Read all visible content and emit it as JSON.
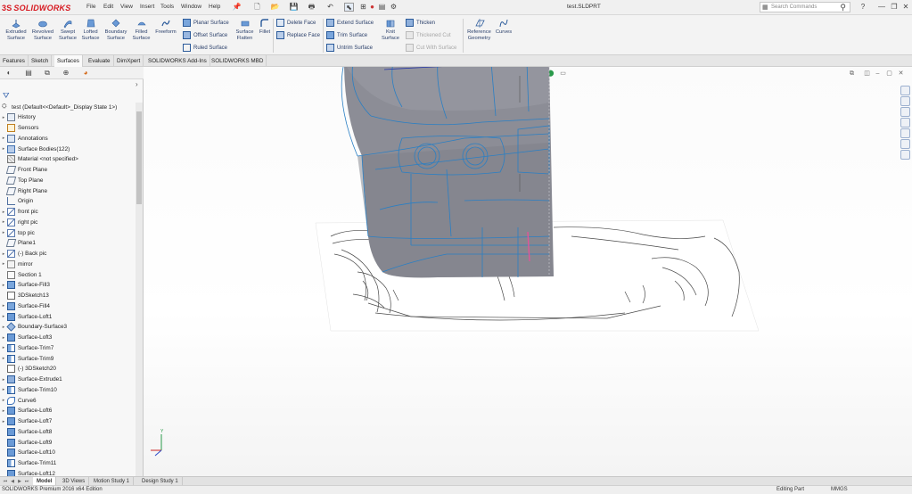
{
  "app": {
    "logo_ds": "3S",
    "logo_text": "SOLIDWORKS",
    "document_title": "test.SLDPRT"
  },
  "menu": [
    "File",
    "Edit",
    "View",
    "Insert",
    "Tools",
    "Window",
    "Help"
  ],
  "search": {
    "placeholder": "Search Commands"
  },
  "window_controls": [
    "?",
    "—",
    "❐",
    "✕"
  ],
  "ribbon": {
    "large_buttons": [
      {
        "label": "Extruded\nSurface",
        "icon": "extruded-surface-icon"
      },
      {
        "label": "Revolved\nSurface",
        "icon": "revolved-surface-icon"
      },
      {
        "label": "Swept\nSurface",
        "icon": "swept-surface-icon"
      },
      {
        "label": "Lofted\nSurface",
        "icon": "lofted-surface-icon"
      },
      {
        "label": "Boundary\nSurface",
        "icon": "boundary-surface-icon"
      },
      {
        "label": "Filled\nSurface",
        "icon": "filled-surface-icon"
      },
      {
        "label": "Freeform",
        "icon": "freeform-icon"
      }
    ],
    "group1": [
      "Planar Surface",
      "Offset Surface",
      "Ruled Surface"
    ],
    "flatten": {
      "label": "Surface\nFlatten"
    },
    "fillet": {
      "label": "Fillet"
    },
    "group2": [
      "Delete Face",
      "Replace Face"
    ],
    "group3": [
      "Extend Surface",
      "Trim Surface",
      "Untrim Surface"
    ],
    "knit": {
      "label": "Knit\nSurface"
    },
    "group4": [
      "Thicken",
      "Thickened Cut",
      "Cut With Surface"
    ],
    "reference_geometry": {
      "label": "Reference\nGeometry"
    },
    "curves": {
      "label": "Curves"
    }
  },
  "cm_tabs": [
    "Features",
    "Sketch",
    "Surfaces",
    "Evaluate",
    "DimXpert",
    "SOLIDWORKS Add-Ins",
    "SOLIDWORKS MBD"
  ],
  "cm_active_tab": "Surfaces",
  "tree": {
    "root": "test  (Default<<Default>_Display State 1>)",
    "items": [
      {
        "label": "History",
        "icon": "history-icon",
        "expand": true
      },
      {
        "label": "Sensors",
        "icon": "sensors-icon",
        "expand": false
      },
      {
        "label": "Annotations",
        "icon": "annotations-icon",
        "expand": true
      },
      {
        "label": "Surface Bodies(122)",
        "icon": "surface-bodies-icon",
        "expand": true
      },
      {
        "label": "Material <not specified>",
        "icon": "material-icon",
        "expand": false
      },
      {
        "label": "Front Plane",
        "icon": "plane-icon",
        "expand": false
      },
      {
        "label": "Top Plane",
        "icon": "plane-icon",
        "expand": false
      },
      {
        "label": "Right Plane",
        "icon": "plane-icon",
        "expand": false
      },
      {
        "label": "Origin",
        "icon": "origin-icon",
        "expand": false
      },
      {
        "label": "front pic",
        "icon": "sketch-icon",
        "expand": true
      },
      {
        "label": "right pic",
        "icon": "sketch-icon",
        "expand": true
      },
      {
        "label": "top pic",
        "icon": "sketch-icon",
        "expand": true
      },
      {
        "label": "Plane1",
        "icon": "plane-icon",
        "expand": false
      },
      {
        "label": "(-) Back pic",
        "icon": "sketch-icon",
        "expand": true
      },
      {
        "label": "mirror",
        "icon": "folder-icon",
        "expand": true
      },
      {
        "label": "Section 1",
        "icon": "section-icon",
        "expand": false
      },
      {
        "label": "Surface-Fill3",
        "icon": "surface-fill-icon",
        "expand": true
      },
      {
        "label": "3DSketch13",
        "icon": "3dsketch-icon",
        "expand": false
      },
      {
        "label": "Surface-Fill4",
        "icon": "surface-fill-icon",
        "expand": true
      },
      {
        "label": "Surface-Loft1",
        "icon": "surface-loft-icon",
        "expand": true
      },
      {
        "label": "Boundary-Surface3",
        "icon": "boundary-surface-icon",
        "expand": true
      },
      {
        "label": "Surface-Loft3",
        "icon": "surface-loft-icon",
        "expand": true
      },
      {
        "label": "Surface-Trim7",
        "icon": "surface-trim-icon",
        "expand": true
      },
      {
        "label": "Surface-Trim9",
        "icon": "surface-trim-icon",
        "expand": true
      },
      {
        "label": "(-) 3DSketch20",
        "icon": "3dsketch-icon",
        "expand": false
      },
      {
        "label": "Surface-Extrude1",
        "icon": "surface-extrude-icon",
        "expand": true
      },
      {
        "label": "Surface-Trim10",
        "icon": "surface-trim-icon",
        "expand": true
      },
      {
        "label": "Curve6",
        "icon": "curve-icon",
        "expand": true
      },
      {
        "label": "Surface-Loft6",
        "icon": "surface-loft-icon",
        "expand": true
      },
      {
        "label": "Surface-Loft7",
        "icon": "surface-loft-icon",
        "expand": true
      },
      {
        "label": "Surface-Loft8",
        "icon": "surface-loft-icon",
        "expand": false
      },
      {
        "label": "Surface-Loft9",
        "icon": "surface-loft-icon",
        "expand": false
      },
      {
        "label": "Surface-Loft10",
        "icon": "surface-loft-icon",
        "expand": false
      },
      {
        "label": "Surface-Trim11",
        "icon": "surface-trim-icon",
        "expand": false
      },
      {
        "label": "Surface-Loft12",
        "icon": "surface-loft-icon",
        "expand": false
      }
    ]
  },
  "bottom_tabs": [
    "Model",
    "3D Views",
    "Motion Study 1",
    "Design Study 1"
  ],
  "bottom_active": "Model",
  "status": {
    "left": "SOLIDWORKS Premium 2016 x64 Edition",
    "mode": "Editing Part",
    "units": "MMGS"
  },
  "colors": {
    "brand_red": "#d71920",
    "ribbon_text": "#2a3f6a",
    "body_gray": "#8c8d96",
    "edge_blue": "#2a7fc4"
  }
}
